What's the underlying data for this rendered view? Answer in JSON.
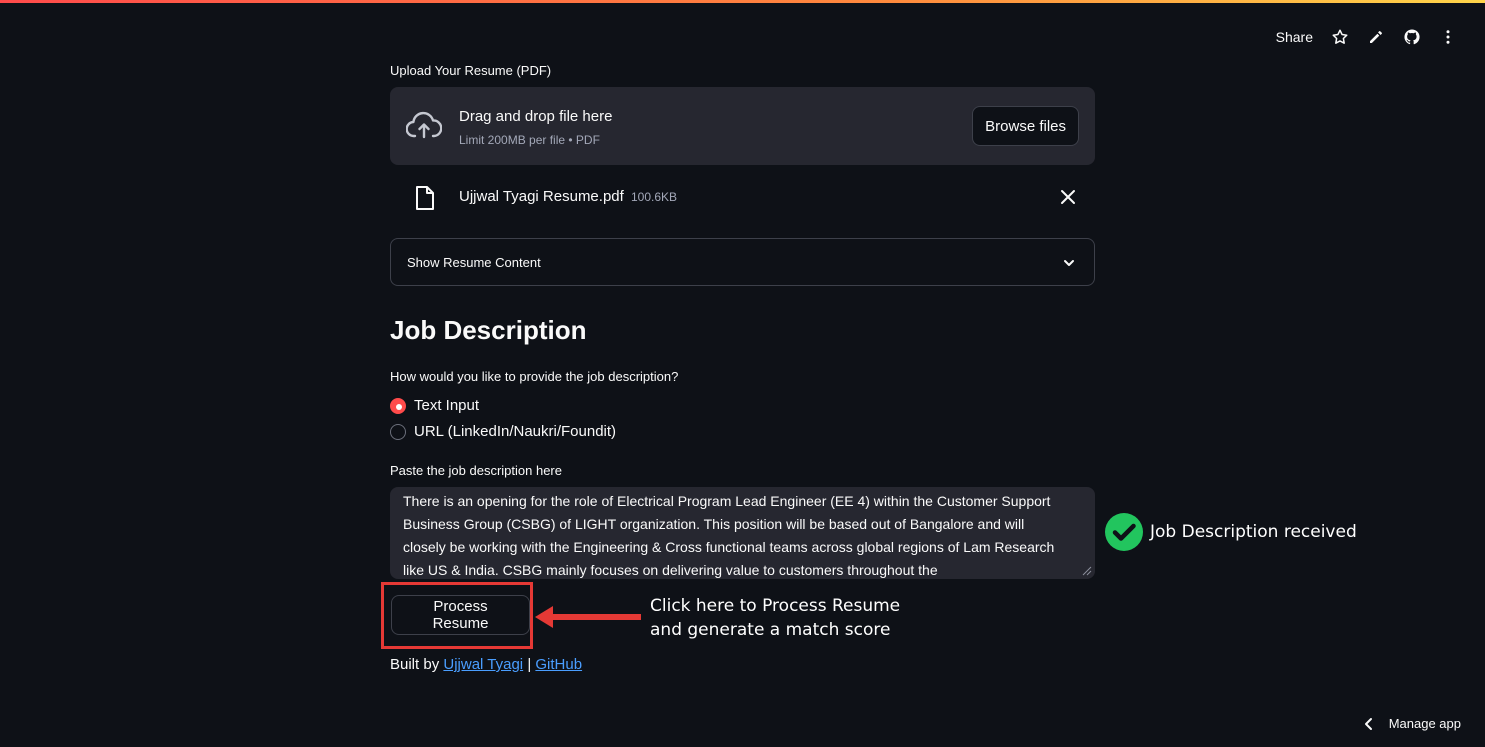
{
  "toolbar": {
    "share_label": "Share",
    "icons": [
      "star-icon",
      "pencil-icon",
      "github-icon",
      "more-vertical-icon"
    ]
  },
  "upload": {
    "label": "Upload Your Resume (PDF)",
    "drop_title": "Drag and drop file here",
    "drop_subtitle": "Limit 200MB per file • PDF",
    "browse_label": "Browse files",
    "file": {
      "name": "Ujjwal Tyagi Resume.pdf",
      "size": "100.6KB"
    }
  },
  "expander": {
    "label": "Show Resume Content"
  },
  "job_description": {
    "heading": "Job Description",
    "question": "How would you like to provide the job description?",
    "options": [
      {
        "label": "Text Input",
        "selected": true
      },
      {
        "label": "URL (LinkedIn/Naukri/Foundit)",
        "selected": false
      }
    ],
    "paste_label": "Paste the job description here",
    "text": "There is an opening for the role of Electrical Program Lead Engineer (EE 4) within the Customer Support Business Group (CSBG) of LIGHT organization. This position will be based out of Bangalore and will closely be working with the Engineering & Cross functional teams across global regions of Lam Research like US & India. CSBG mainly focuses on delivering value to customers throughout the"
  },
  "process": {
    "button_label": "Process Resume"
  },
  "footer": {
    "prefix": "Built by",
    "author": "Ujjwal Tyagi",
    "separator": "|",
    "github": "GitHub"
  },
  "annotations": {
    "process_hint_line1": "Click here to Process Resume",
    "process_hint_line2": "and generate a match score",
    "status": "Job Description received"
  },
  "manage_app": {
    "label": "Manage app"
  },
  "colors": {
    "background": "#0e1117",
    "surface": "#262730",
    "accent": "#ff4b4b",
    "highlight_box": "#e53935",
    "success": "#22c55e",
    "link": "#4a9eff"
  }
}
